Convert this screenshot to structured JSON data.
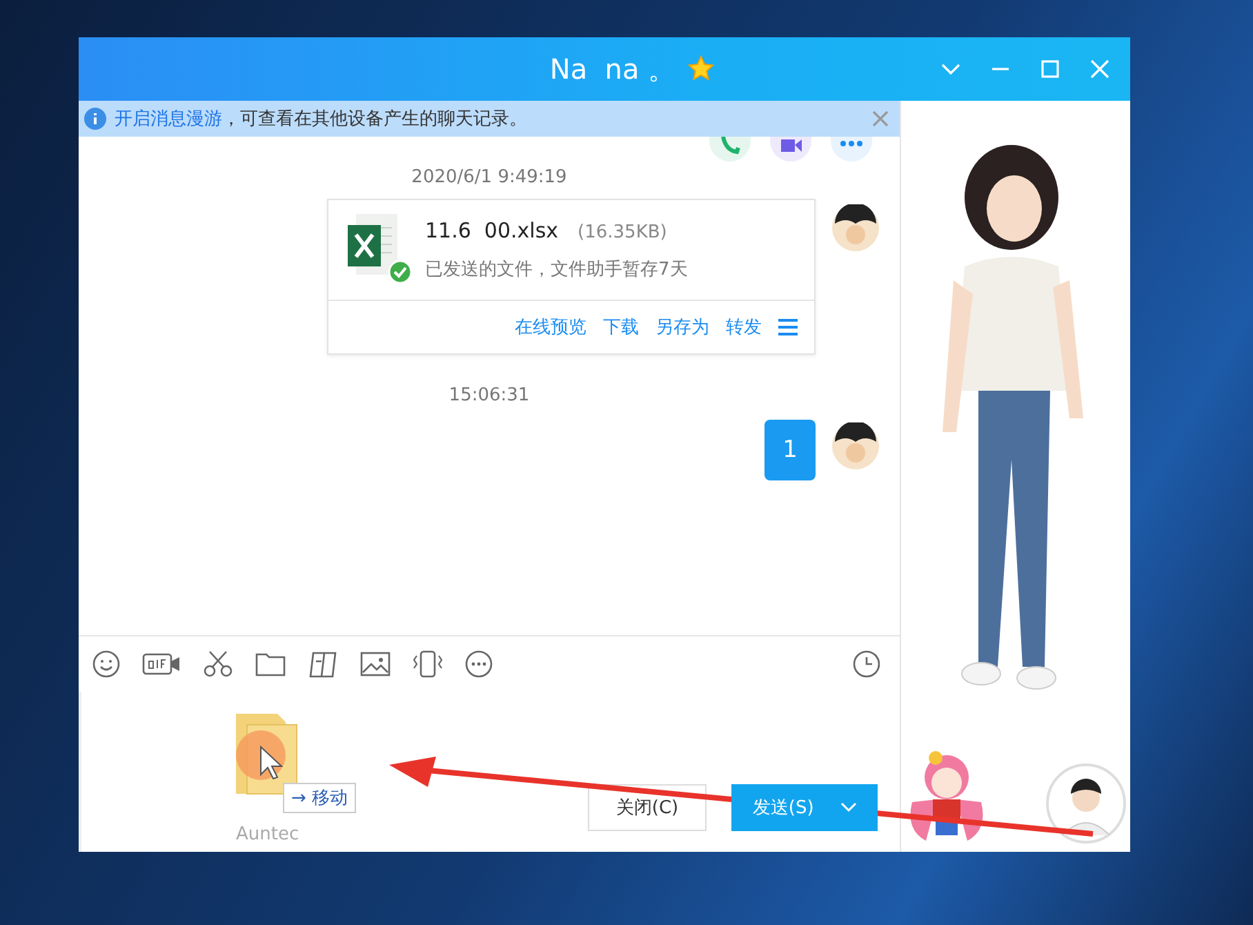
{
  "window": {
    "title": "Na  na 。"
  },
  "notice": {
    "link": "开启消息漫游",
    "text": "，可查看在其他设备产生的聊天记录。"
  },
  "messages": [
    {
      "kind": "file",
      "time": "2020/6/1 9:49:19",
      "file_name": "11.6  00.xlsx",
      "size": "(16.35KB)",
      "status": "已发送的文件，文件助手暂存7天",
      "actions": [
        "在线预览",
        "下载",
        "另存为",
        "转发"
      ]
    },
    {
      "kind": "text",
      "time": "15:06:31",
      "text": "1"
    }
  ],
  "drag": {
    "hint": "→ 移动",
    "file_label": "Auntec"
  },
  "buttons": {
    "close": "关闭(C)",
    "send": "发送(S)"
  }
}
